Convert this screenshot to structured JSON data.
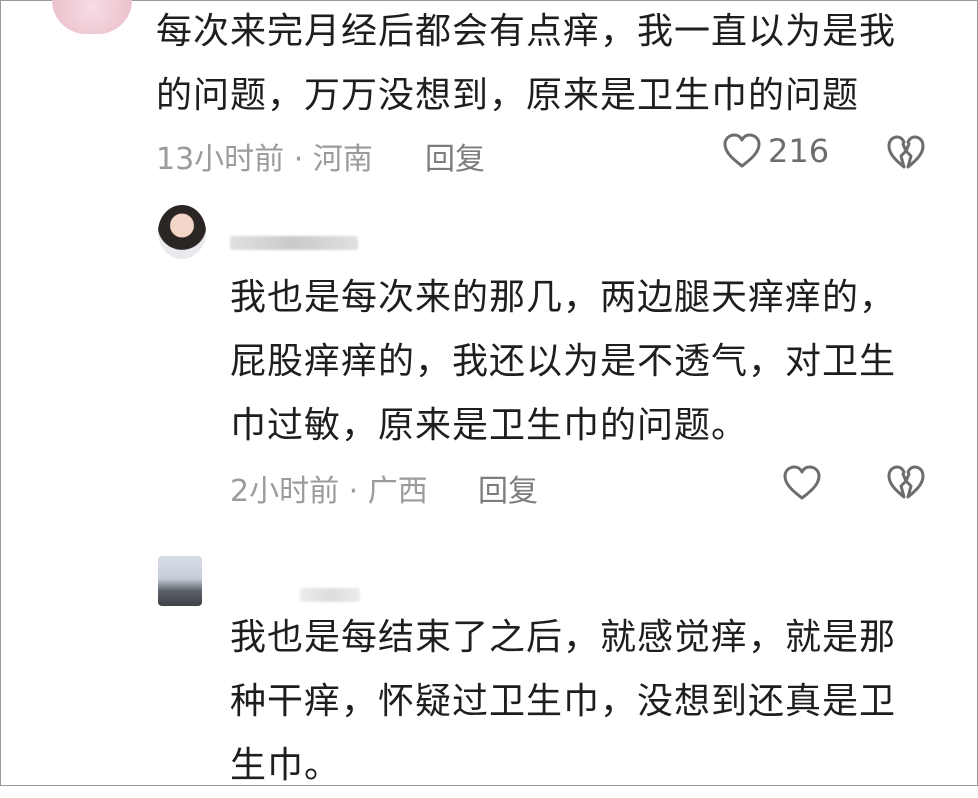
{
  "comments": [
    {
      "text_line1": "每次来完月经后都会有点痒，我一直以为是我",
      "text_line2": "的问题，万万没想到，原来是卫生巾的问题",
      "time": "13小时前",
      "separator": "·",
      "location": "河南",
      "reply_label": "回复",
      "like_count": "216",
      "like_icon": "heart-outline-icon",
      "dislike_icon": "broken-heart-icon"
    },
    {
      "text_line1": "我也是每次来的那几，两边腿天痒痒的，",
      "text_line2": "屁股痒痒的，我还以为是不透气，对卫生",
      "text_line3": "巾过敏，原来是卫生巾的问题。",
      "time": "2小时前",
      "separator": "·",
      "location": "广西",
      "reply_label": "回复",
      "like_icon": "heart-outline-icon",
      "dislike_icon": "broken-heart-icon"
    },
    {
      "text_line1": "我也是每结束了之后，就感觉痒，就是那",
      "text_line2": "种干痒，怀疑过卫生巾，没想到还真是卫",
      "text_line3": "生巾。"
    }
  ],
  "colors": {
    "meta_gray": "#9b9b9b",
    "icon_gray": "#6d6d6d",
    "text": "#1e1e1e"
  }
}
